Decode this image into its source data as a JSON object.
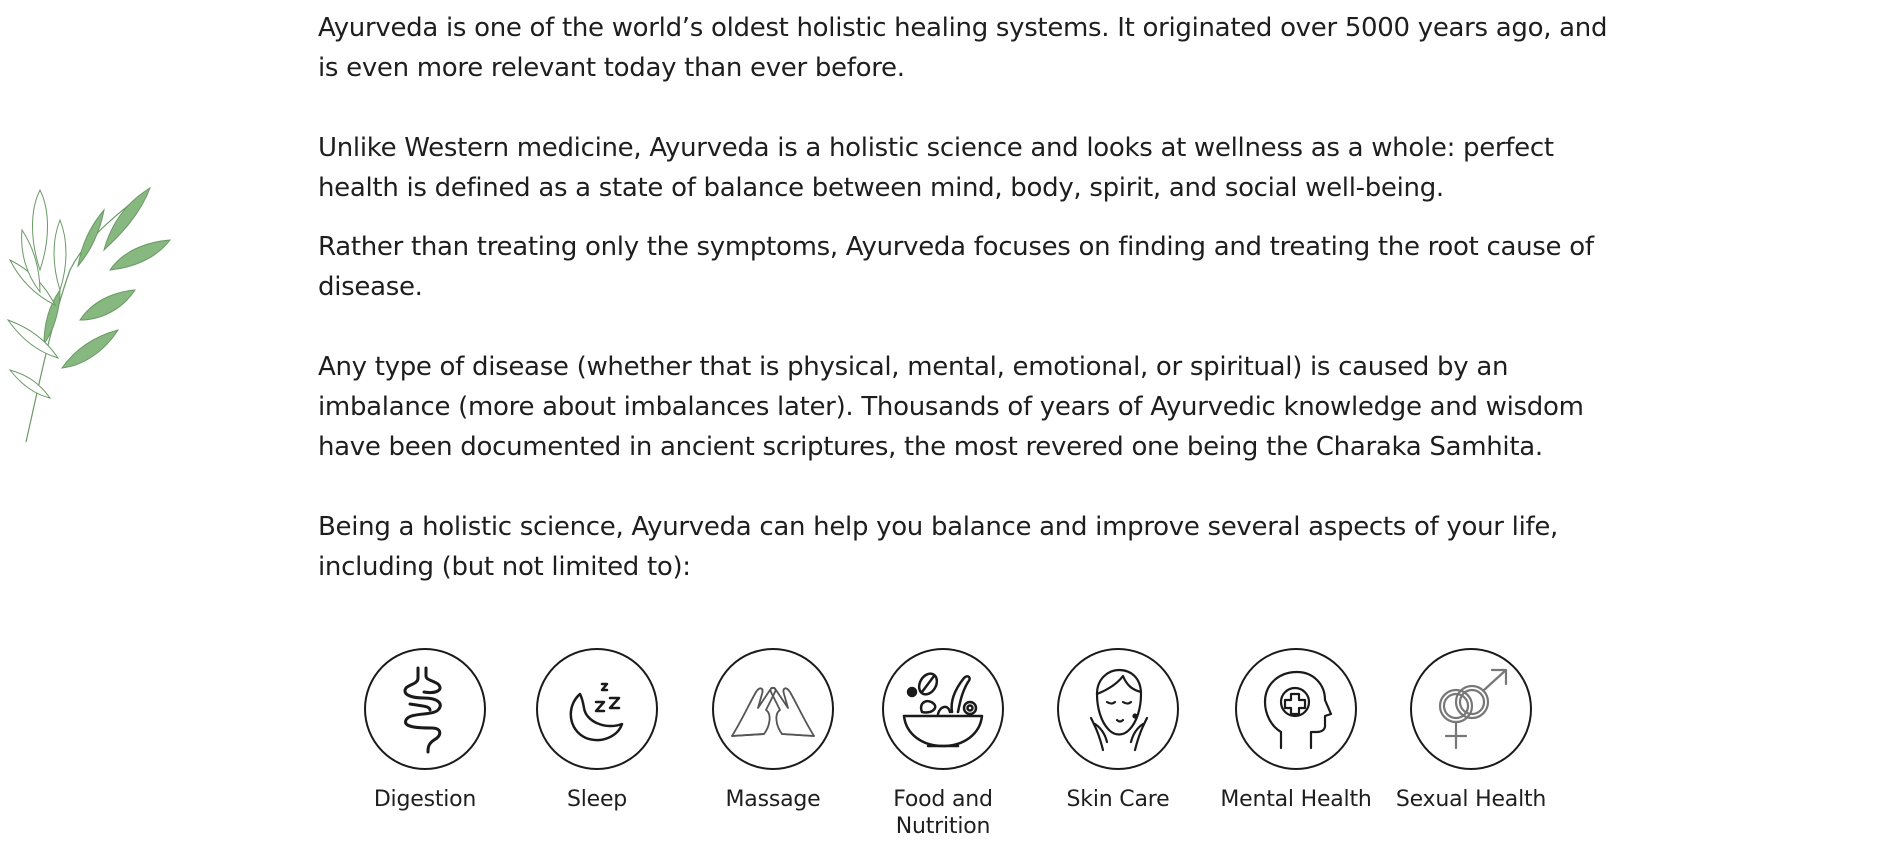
{
  "paragraphs": [
    "Ayurveda is one of the world’s oldest holistic healing systems. It originated over 5000 years ago, and is even more relevant today than ever before.",
    "Unlike Western medicine, Ayurveda is a holistic science and looks at wellness as a whole: perfect health is defined as a state of balance between mind, body, spirit, and social well-being.",
    "Rather than treating only the symptoms, Ayurveda focuses on finding and treating the root cause of disease.",
    "Any type of disease (whether that is physical, mental, emotional, or spiritual) is caused by an imbalance (more about imbalances later). Thousands of years of Ayurvedic knowledge and wisdom have been documented in ancient scriptures, the most revered one being the Charaka Samhita.",
    "Being a holistic science, Ayurveda can help you balance and improve several aspects of your life, including (but not limited to):"
  ],
  "decoration": {
    "leaf_icon": "olive-branch-icon",
    "leaf_color": "#7fb07a"
  },
  "aspects": [
    {
      "label": "Digestion",
      "icon": "intestines-icon"
    },
    {
      "label": "Sleep",
      "icon": "moon-sleep-icon"
    },
    {
      "label": "Massage",
      "icon": "massage-hands-icon"
    },
    {
      "label": "Food and Nutrition",
      "icon": "food-bowl-icon"
    },
    {
      "label": "Skin Care",
      "icon": "face-care-icon"
    },
    {
      "label": "Mental Health",
      "icon": "head-health-icon"
    },
    {
      "label": "Sexual Health",
      "icon": "gender-symbols-icon"
    }
  ]
}
